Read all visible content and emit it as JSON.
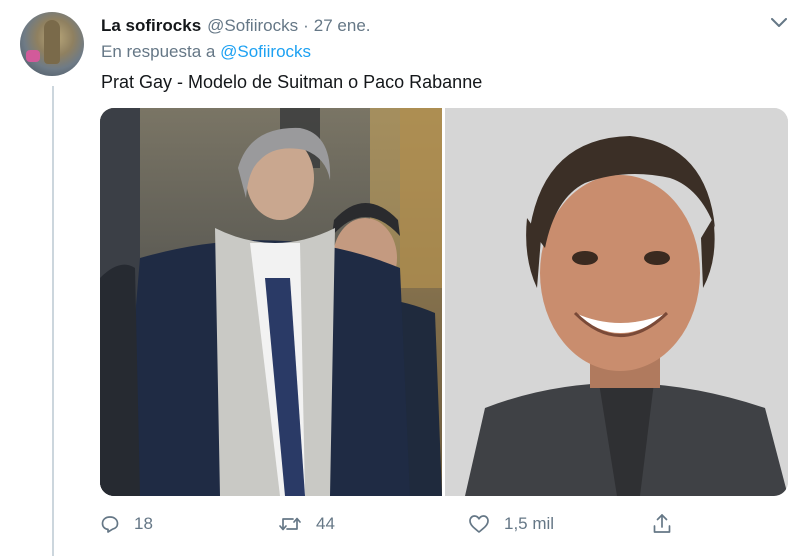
{
  "tweet": {
    "display_name": "La sofirocks",
    "handle": "@Sofiirocks",
    "separator": "·",
    "date": "27 ene.",
    "reply_prefix": "En respuesta a",
    "reply_to": "@Sofiirocks",
    "text": "Prat Gay - Modelo de Suitman o Paco Rabanne",
    "media": [
      {
        "icon": "photo-man-in-suit-and-scarf"
      },
      {
        "icon": "photo-smiling-man-portrait"
      }
    ]
  },
  "actions": {
    "reply_count": "18",
    "retweet_count": "44",
    "like_count": "1,5 mil"
  },
  "colors": {
    "text": "#14171a",
    "secondary": "#657786",
    "link": "#1da1f2",
    "thread_line": "#ccd6dd"
  },
  "icons": [
    "reply-icon",
    "retweet-icon",
    "like-icon",
    "share-icon",
    "chevron-down-icon"
  ]
}
